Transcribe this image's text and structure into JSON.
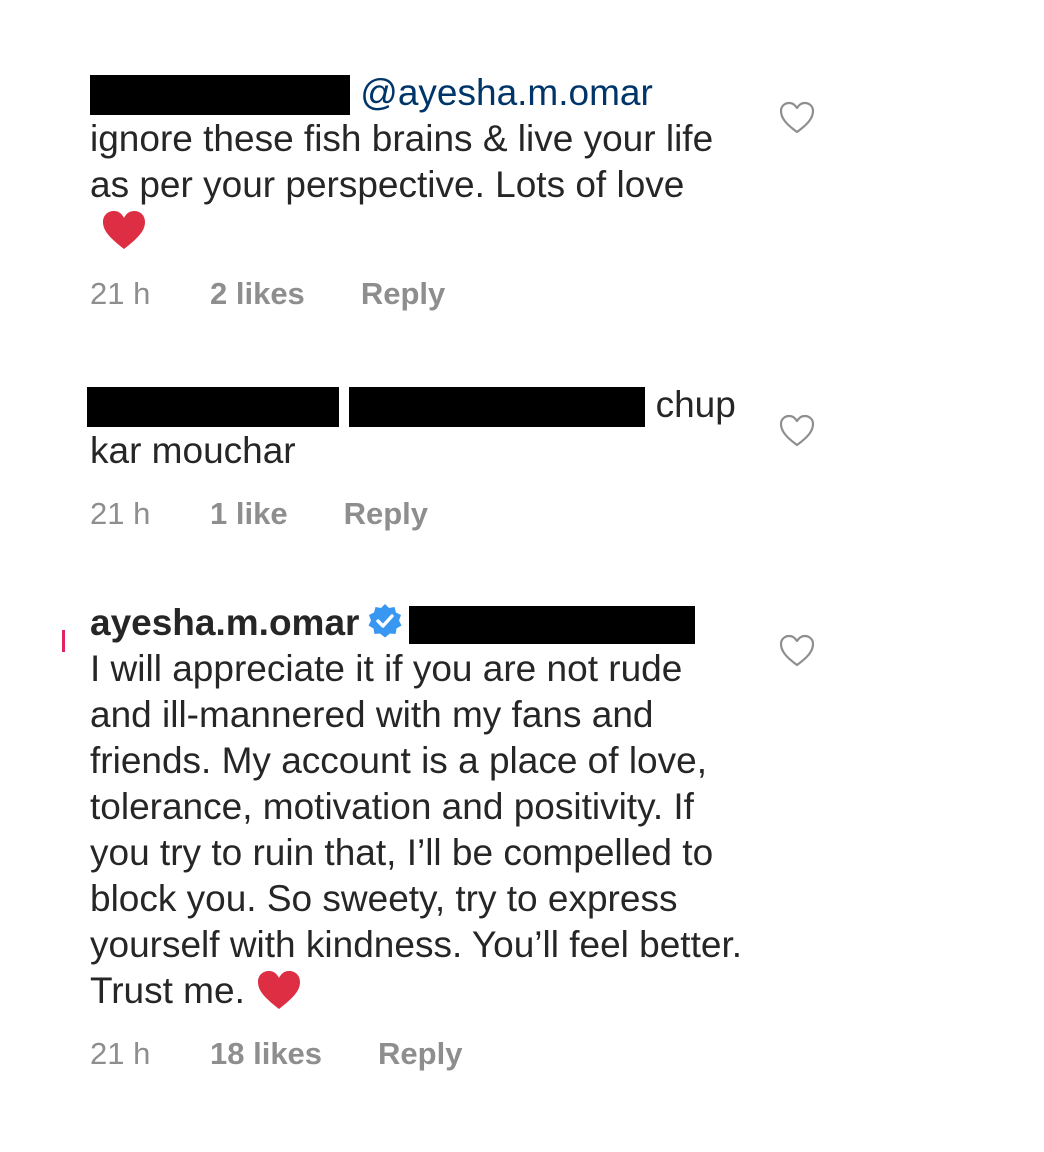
{
  "comments": [
    {
      "mention": "@ayesha.m.omar",
      "text": "ignore these fish brains & live your life as per your perspective. Lots of love",
      "time": "21 h",
      "likes": "2 likes",
      "reply": "Reply"
    },
    {
      "text_tail": "chup",
      "text": "kar mouchar",
      "time": "21 h",
      "likes": "1 like",
      "reply": "Reply"
    },
    {
      "username": "ayesha.m.omar",
      "text": "I will appreciate it if you are not rude and ill-mannered with my fans and friends. My account is a place of love, tolerance, motivation and positivity. If you try to ruin that, I’ll be compelled to block you. So sweety, try to express yourself with kindness. You’ll feel better. Trust me.",
      "time": "21 h",
      "likes": "18 likes",
      "reply": "Reply"
    }
  ],
  "colors": {
    "text": "#262626",
    "mention": "#003569",
    "meta": "#8e8e8e",
    "verified": "#3897f0",
    "heart_emoji": "#dd2e44"
  },
  "icons": [
    "heart-emoji",
    "verified-badge-icon",
    "like-heart-icon"
  ]
}
